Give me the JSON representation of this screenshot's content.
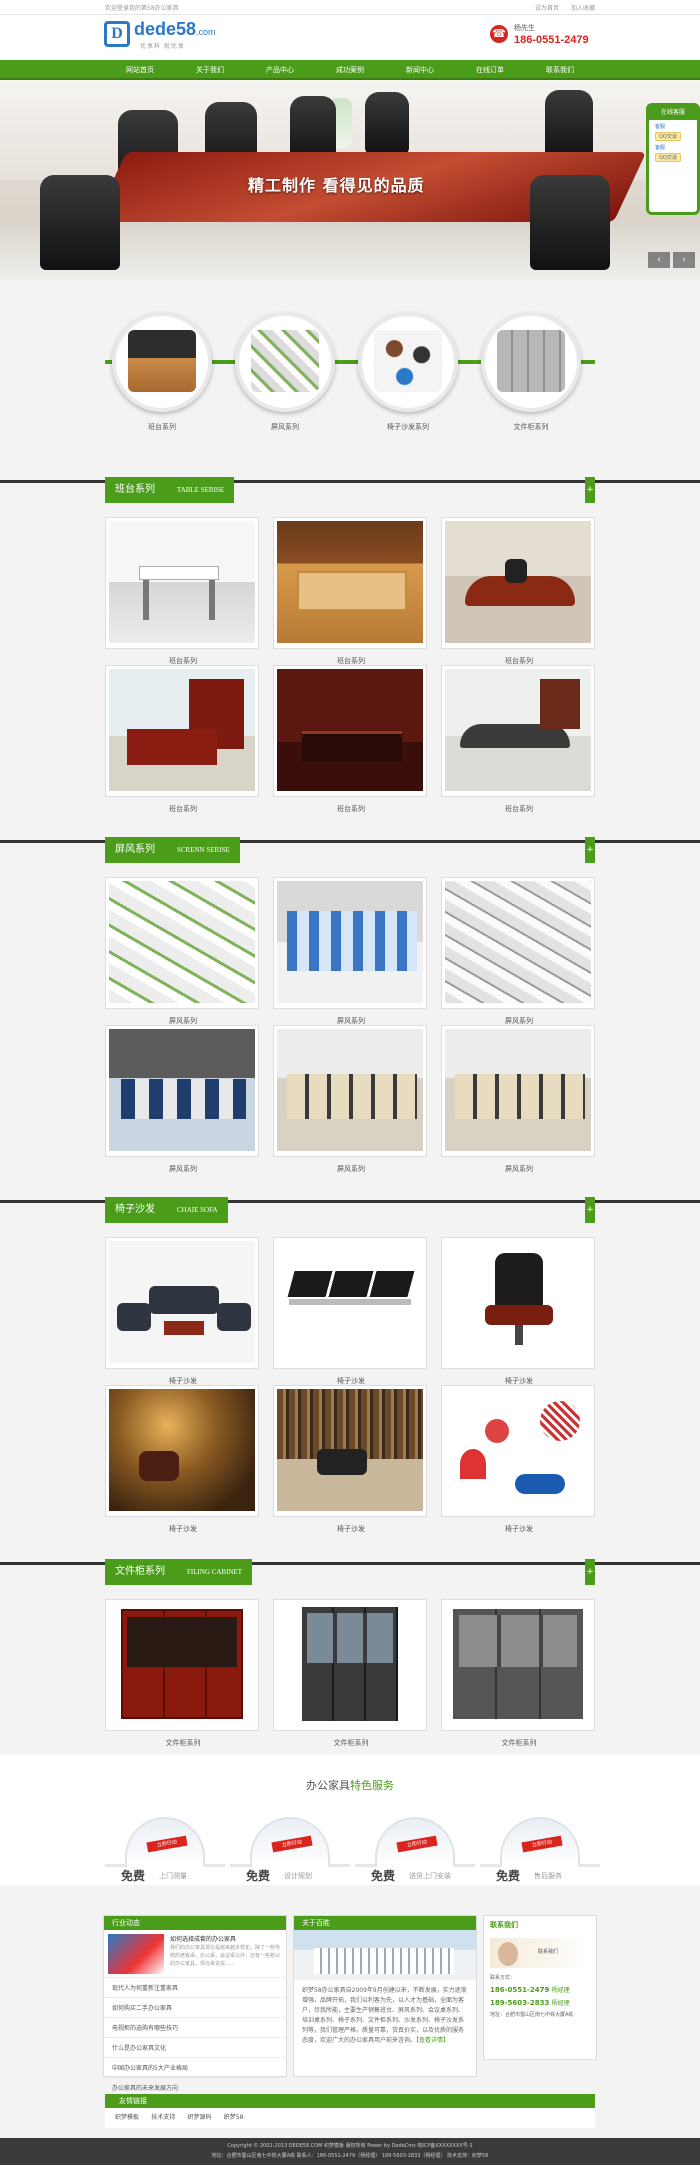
{
  "topbar": {
    "welcome": "欢迎登录我的第58办公家具",
    "links": [
      "设为首页",
      "加入收藏"
    ]
  },
  "header": {
    "logo_main": "dede58",
    "logo_suffix": ".com",
    "logo_slogan": "优享科 就优享",
    "contact_name": "杨先生",
    "contact_phone": "186-0551-2479"
  },
  "nav": [
    "网站首页",
    "关于我们",
    "产品中心",
    "成功案例",
    "新闻中心",
    "在线订单",
    "联系我们"
  ],
  "banner": {
    "slogan": "精工制作 看得见的品质",
    "prev": "‹",
    "next": "›"
  },
  "service_float": {
    "title": "在线客服",
    "items": [
      {
        "name": "客服",
        "btn": "QQ交谈"
      },
      {
        "name": "客服",
        "btn": "QQ交谈"
      }
    ]
  },
  "circles": [
    "班台系列",
    "屏风系列",
    "椅子沙发系列",
    "文件柜系列"
  ],
  "sections": [
    {
      "title": "班台系列",
      "en": "TABLE SERISE",
      "items": [
        "班台系列",
        "班台系列",
        "班台系列",
        "班台系列",
        "班台系列",
        "班台系列"
      ]
    },
    {
      "title": "屏风系列",
      "en": "SCRENN SERISE",
      "items": [
        "屏风系列",
        "屏风系列",
        "屏风系列",
        "屏风系列",
        "屏风系列",
        "屏风系列"
      ]
    },
    {
      "title": "椅子沙发",
      "en": "CHAIE SOFA",
      "items": [
        "椅子沙发",
        "椅子沙发",
        "椅子沙发",
        "椅子沙发",
        "椅子沙发",
        "椅子沙发"
      ]
    },
    {
      "title": "文件柜系列",
      "en": "FILING CABINET",
      "items": [
        "文件柜系列",
        "文件柜系列",
        "文件柜系列"
      ]
    }
  ],
  "services": {
    "title_prefix": "办公家具",
    "title_highlight": "特色服务",
    "items": [
      {
        "free": "免费",
        "label": "上门测量",
        "tag": "立即行动"
      },
      {
        "free": "免费",
        "label": "设计规划",
        "tag": "立即行动"
      },
      {
        "free": "免费",
        "label": "送货上门安装",
        "tag": "立即行动"
      },
      {
        "free": "免费",
        "label": "售后服务",
        "tag": "立即行动"
      }
    ]
  },
  "news": {
    "title": "行业动态",
    "featured_title": "如何选择成套的办公家具",
    "featured_text": "我们的办公家具现在是越来越多样化，除了一些传统的老板桌，办公桌，会议桌以外，还有一些新兴的办公家具，现在来说说……",
    "items": [
      "现代人为何重新注重家具",
      "如何购买二手办公家具",
      "电视柜的选购有哪些技巧",
      "什么是办公家具文化",
      "中国办公家具的5大产业格局",
      "办公家具的未来发展方向"
    ]
  },
  "about": {
    "title": "关于百胜",
    "text": "织梦58办公家具自2009年9月创建以来，不断发展，实力逐渐增强，品牌开拓，我们以利客为先，以人才为基础，全面为客户，尽我所能，主要生产销售班台、屏风系列、会议桌系列、培训桌系列、椅子系列、文件柜系列、沙发系列、椅子沙发系列等，我们管理严格，质量可靠，货真价实，以及优质的服务态度，欢迎广大的办公家具用户前来咨询。",
    "more": "【查看详情】"
  },
  "contact": {
    "title": "联系我们",
    "label": "联系方式：",
    "phone1": "186-0551-2479",
    "name1": "杨经理",
    "phone2": "189-5603-2833",
    "name2": "杨经理",
    "addr": "地址：合肥市蜀山区南七中铁大厦A栋",
    "img_label": "联系我们"
  },
  "friends": {
    "title": "友情链接",
    "links": [
      "织梦模板",
      "技术支持",
      "织梦源码",
      "织梦58"
    ]
  },
  "footer": {
    "line1": "Copyright © 2002-2013 DEDE58.COM 织梦模板 版权所有 Power by DedeCms   皖ICP备XXXXXXXX号-1",
    "line2": "地址：合肥市蜀山区南七中铁大厦A栋   联系人：186-0551-2479（杨经理） 189-5603-2833（杨经理） 技术支持：织梦58"
  },
  "colors": {
    "brand_green": "#4b9c1a",
    "phone_red": "#d9251d",
    "logo_blue": "#2b78c6"
  }
}
